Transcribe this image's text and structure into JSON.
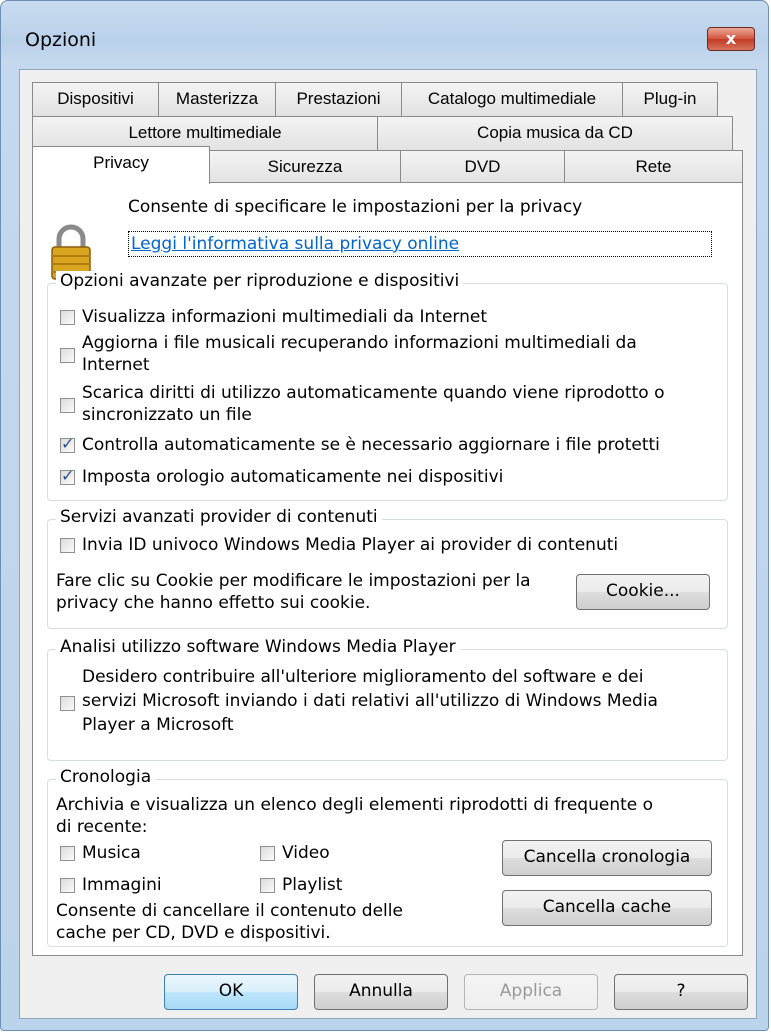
{
  "window": {
    "title": "Opzioni",
    "close_label": "x"
  },
  "tabs": {
    "row1": [
      "Dispositivi",
      "Masterizza",
      "Prestazioni",
      "Catalogo multimediale",
      "Plug-in"
    ],
    "row2": [
      "Lettore multimediale",
      "Copia musica da CD"
    ],
    "row3": [
      "Privacy",
      "Sicurezza",
      "DVD",
      "Rete"
    ],
    "active": "Privacy"
  },
  "privacy": {
    "description": "Consente di specificare le impostazioni per la privacy",
    "link": "Leggi l'informativa sulla privacy online"
  },
  "playback_options": {
    "legend": "Opzioni avanzate per riproduzione e dispositivi",
    "items": [
      {
        "lines": [
          "Visualizza informazioni multimediali da Internet"
        ],
        "checked": false
      },
      {
        "lines": [
          "Aggiorna i file musicali recuperando informazioni multimediali da",
          "Internet"
        ],
        "checked": false
      },
      {
        "lines": [
          "Scarica diritti di utilizzo automaticamente quando viene riprodotto o",
          "sincronizzato un file"
        ],
        "checked": false
      },
      {
        "lines": [
          "Controlla automaticamente se è necessario aggiornare i file protetti"
        ],
        "checked": true
      },
      {
        "lines": [
          "Imposta orologio automaticamente nei dispositivi"
        ],
        "checked": true
      }
    ]
  },
  "content_providers": {
    "legend": "Servizi avanzati provider di contenuti",
    "send_id": {
      "label": "Invia ID univoco Windows Media Player ai provider di contenuti",
      "checked": false
    },
    "cookie_text": [
      "Fare clic su Cookie per modificare le impostazioni per la",
      "privacy che hanno effetto sui cookie."
    ],
    "cookie_button": "Cookie..."
  },
  "usage_analysis": {
    "legend": "Analisi utilizzo software Windows Media Player",
    "lines": [
      "Desidero contribuire all'ulteriore miglioramento del software e dei",
      "servizi Microsoft inviando i dati relativi all'utilizzo di Windows Media",
      "Player a Microsoft"
    ],
    "checked": false
  },
  "history": {
    "legend": "Cronologia",
    "description": [
      "Archivia e visualizza un elenco degli elementi riprodotti di frequente o",
      "di recente:"
    ],
    "music": {
      "label": "Musica",
      "checked": false
    },
    "video": {
      "label": "Video",
      "checked": false
    },
    "images": {
      "label": "Immagini",
      "checked": false
    },
    "playlist": {
      "label": "Playlist",
      "checked": false
    },
    "clear_history_button": "Cancella cronologia",
    "clear_cache_text": [
      "Consente di cancellare il contenuto delle",
      "cache per CD, DVD e dispositivi."
    ],
    "clear_cache_button": "Cancella cache"
  },
  "footer": {
    "ok": "OK",
    "cancel": "Annulla",
    "apply": "Applica",
    "help": "?"
  }
}
